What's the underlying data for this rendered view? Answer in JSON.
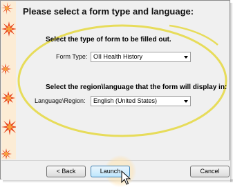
{
  "dialog": {
    "heading": "Please select a form type and language:"
  },
  "form_section": {
    "label": "Select the type of form to be filled out.",
    "field_label": "Form Type:",
    "selected": "OII Health History"
  },
  "language_section": {
    "label": "Select the region\\language that the form will display in:",
    "field_label": "Language\\Region:",
    "selected": "English (United States)"
  },
  "buttons": {
    "back": "< Back",
    "launch": "Launch",
    "cancel": "Cancel"
  },
  "colors": {
    "highlight_ellipse": "#e7dc5a",
    "side_panel": "#fcecd5",
    "flower": "#e8471f"
  }
}
